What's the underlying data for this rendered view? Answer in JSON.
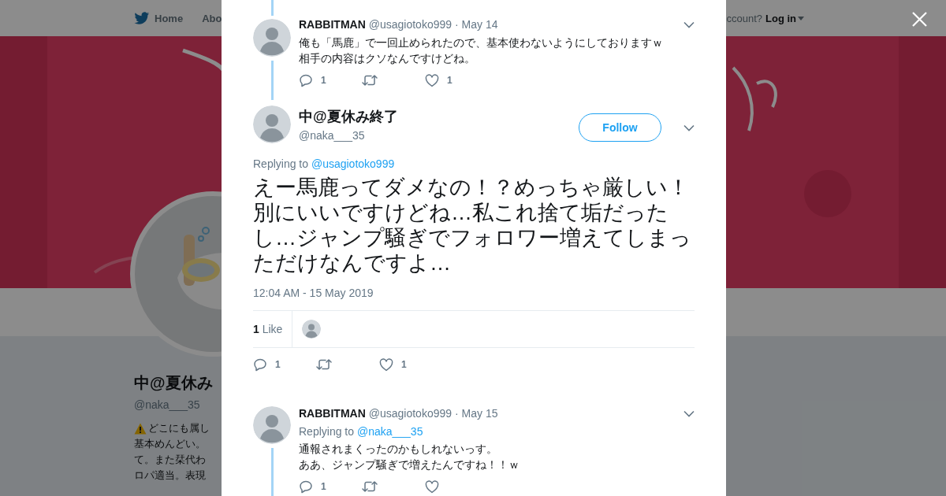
{
  "page": {
    "nav": {
      "items": [
        "Home",
        "Abo"
      ],
      "account_prompt": "ccount?",
      "login": "Log in"
    },
    "profile": {
      "name": "中@夏休み",
      "handle": "@naka___35",
      "bio_lines": [
        "どこにも属し",
        "基本めんどい。",
        "て。また栞代わ",
        "ロパ適当。表現"
      ]
    }
  },
  "tweet_dialog": {
    "tweets": [
      {
        "kind": "reply",
        "name": "RABBITMAN",
        "handle": "@usagiotoko999",
        "date": "· May 14",
        "text_lines": [
          "俺も「馬鹿」で一回止められたので、基本使わないようにしておりますｗ",
          "相手の内容はクソなんですけどね。"
        ],
        "reply_count": "1",
        "like_count": "1"
      },
      {
        "kind": "focus",
        "name": "中@夏休み終了",
        "handle": "@naka___35",
        "follow_label": "Follow",
        "replying_to_prefix": "Replying to",
        "replying_to": "@usagiotoko999",
        "text": "えー馬鹿ってダメなの！？めっちゃ厳しい！別にいいですけどね…私これ捨て垢だったし…ジャンプ騒ぎでフォロワー増えてしまっただけなんですよ…",
        "timestamp": "12:04 AM - 15 May 2019",
        "likes_summary": "**1** Like",
        "reply_count": "1",
        "like_count": "1"
      },
      {
        "kind": "reply",
        "name": "RABBITMAN",
        "handle": "@usagiotoko999",
        "date": "· May 15",
        "replying_to_prefix": "Replying to",
        "replying_to": "@naka___35",
        "text_lines": [
          "通報されまくったのかもしれないっす。",
          "ああ、ジャンプ騒ぎで増えたんですね！！ｗ"
        ],
        "reply_count": "1"
      }
    ]
  }
}
